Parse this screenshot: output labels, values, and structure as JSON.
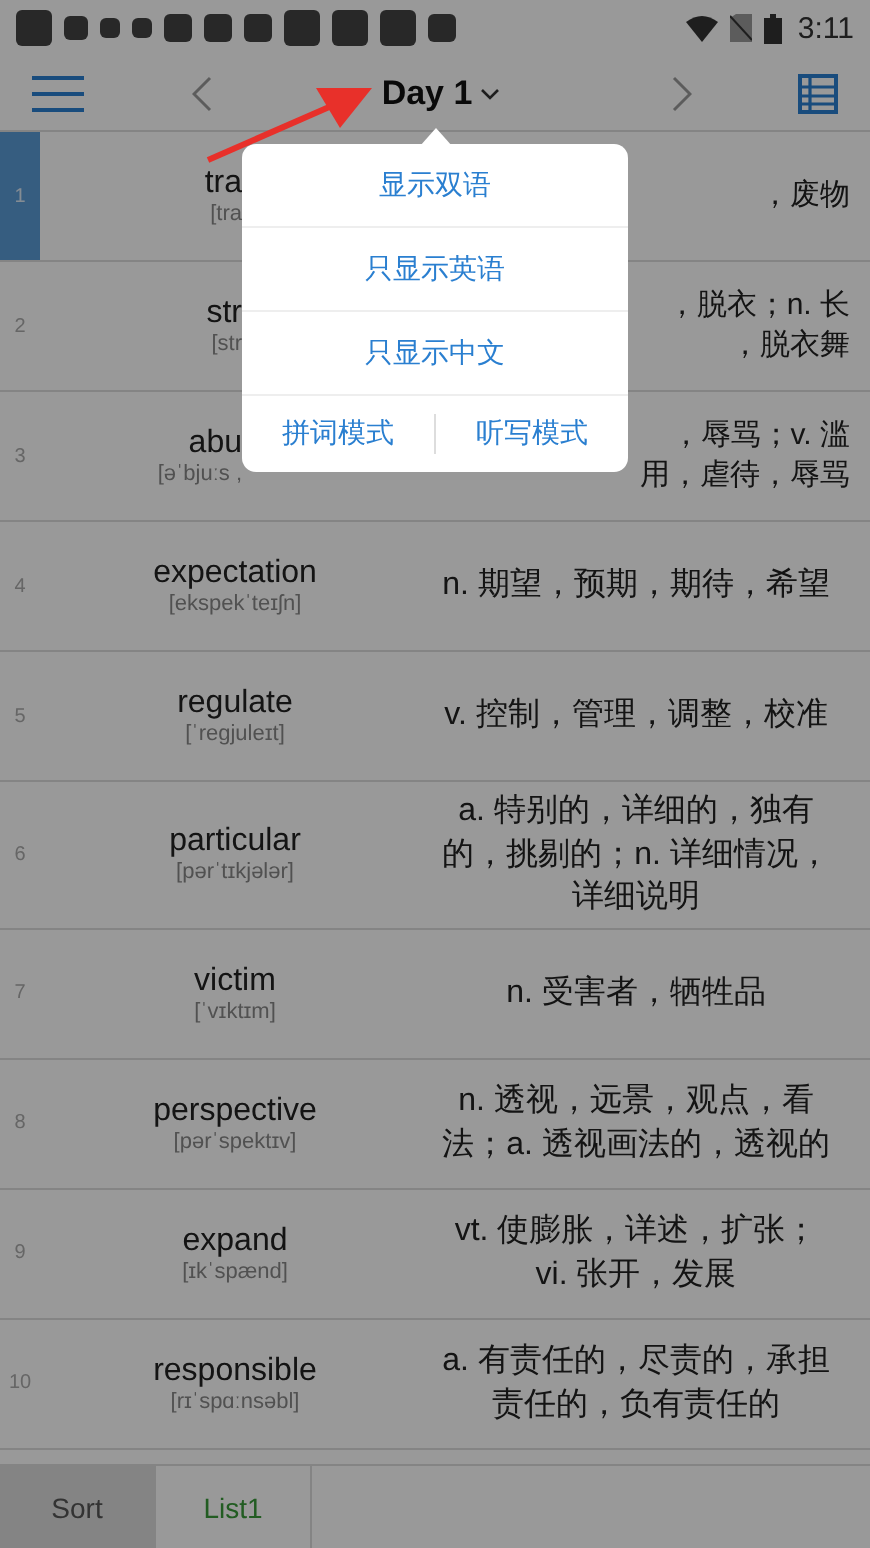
{
  "status_bar": {
    "time": "3:11"
  },
  "header": {
    "title": "Day 1"
  },
  "rows": [
    {
      "index": "1",
      "word": "tra",
      "phonetic": "[tra",
      "meaning_lines": [
        "，废物"
      ],
      "selected": true,
      "kind": "covered"
    },
    {
      "index": "2",
      "word": "str",
      "phonetic": "[str",
      "meaning_lines": [
        "，脱衣；n. 长",
        "，脱衣舞"
      ],
      "selected": false,
      "kind": "covered"
    },
    {
      "index": "3",
      "word": "abu",
      "phonetic": "[əˈbjuːs ,",
      "meaning_lines": [
        "，辱骂；v. 滥",
        "用，虐待，辱骂"
      ],
      "selected": false,
      "kind": "covered"
    },
    {
      "index": "4",
      "word": "expectation",
      "phonetic": "[ekspekˈteɪʃn]",
      "meaning": "n. 期望，预期，期待，希望",
      "selected": false,
      "kind": "plain"
    },
    {
      "index": "5",
      "word": "regulate",
      "phonetic": "[ˈregjuleɪt]",
      "meaning": "v. 控制，管理，调整，校准",
      "selected": false,
      "kind": "plain"
    },
    {
      "index": "6",
      "word": "particular",
      "phonetic": "[pərˈtɪkjələr]",
      "meaning": "a. 特别的，详细的，独有的，挑剔的；n. 详细情况，详细说明",
      "selected": false,
      "kind": "plain"
    },
    {
      "index": "7",
      "word": "victim",
      "phonetic": "[ˈvɪktɪm]",
      "meaning": "n. 受害者，牺牲品",
      "selected": false,
      "kind": "plain"
    },
    {
      "index": "8",
      "word": "perspective",
      "phonetic": "[pərˈspektɪv]",
      "meaning": "n. 透视，远景，观点，看法；a. 透视画法的，透视的",
      "selected": false,
      "kind": "plain"
    },
    {
      "index": "9",
      "word": "expand",
      "phonetic": "[ɪkˈspænd]",
      "meaning": "vt. 使膨胀，详述，扩张；vi. 张开，发展",
      "selected": false,
      "kind": "plain"
    },
    {
      "index": "10",
      "word": "responsible",
      "phonetic": "[rɪˈspɑːnsəbl]",
      "meaning": "a. 有责任的，尽责的，承担责任的，负有责任的",
      "selected": false,
      "kind": "plain"
    }
  ],
  "menu": {
    "items": [
      {
        "label": "显示双语"
      },
      {
        "label": "只显示英语"
      },
      {
        "label": "只显示中文"
      }
    ],
    "modes": [
      {
        "label": "拼词模式"
      },
      {
        "label": "听写模式"
      }
    ]
  },
  "tabs": [
    {
      "label": "Sort",
      "selected": false
    },
    {
      "label": "List1",
      "selected": true
    }
  ]
}
